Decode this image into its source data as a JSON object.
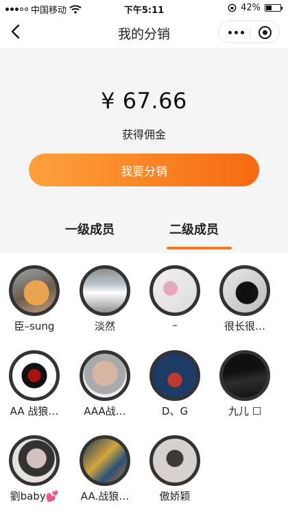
{
  "status_bar": {
    "carrier": "中国移动",
    "time": "下午5:11",
    "battery": "42%",
    "battery_level": 0.42,
    "icons": [
      "signal-icon",
      "wifi-icon",
      "orientation-lock-icon",
      "battery-icon"
    ]
  },
  "nav": {
    "title": "我的分销",
    "icons": [
      "back-chevron-icon",
      "more-dots-icon",
      "target-icon"
    ]
  },
  "hero": {
    "amount": "¥ 67.66",
    "label": "获得佣金",
    "cta_label": "我要分销",
    "cta_colors": [
      "#fda13c",
      "#f76a10"
    ]
  },
  "tabs": [
    {
      "label": "一级成员",
      "active": false
    },
    {
      "label": "二级成员",
      "active": true
    }
  ],
  "accent_color": "#f47a1e",
  "members": [
    {
      "name": "臣–sung"
    },
    {
      "name": "淡然"
    },
    {
      "name": "–"
    },
    {
      "name": "很长很…"
    },
    {
      "name": "AA 战狼…"
    },
    {
      "name": "AAA战…"
    },
    {
      "name": "D、G"
    },
    {
      "name": "九儿 ☐"
    },
    {
      "name": "劉baby💕"
    },
    {
      "name": "AA.战狼…"
    },
    {
      "name": "傲娇颖"
    }
  ]
}
